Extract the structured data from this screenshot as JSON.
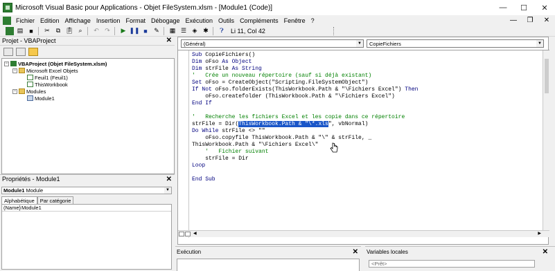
{
  "window": {
    "title": "Microsoft Visual Basic pour Applications - Objet FileSystem.xlsm - [Module1 (Code)]",
    "controls": {
      "minimize": "—",
      "maximize": "☐",
      "close": "✕"
    }
  },
  "menubar": {
    "items": [
      "Fichier",
      "Edition",
      "Affichage",
      "Insertion",
      "Format",
      "Débogage",
      "Exécution",
      "Outils",
      "Compléments",
      "Fenêtre",
      "?"
    ],
    "doc_controls": {
      "minimize": "—",
      "restore": "❐",
      "close": "✕"
    }
  },
  "toolbar": {
    "position": "Li 11, Col 42",
    "icons": [
      "excel-icon",
      "insert-icon",
      "save-icon",
      "cut-icon",
      "copy-icon",
      "paste-icon",
      "find-icon",
      "undo-icon",
      "redo-icon",
      "run-icon",
      "break-icon",
      "reset-icon",
      "design-icon",
      "project-explorer-icon",
      "properties-icon",
      "object-browser-icon",
      "toolbox-icon",
      "help-icon"
    ]
  },
  "project_panel": {
    "title": "Projet - VBAProject",
    "close": "✕",
    "tree": [
      {
        "level": 0,
        "expander": "−",
        "icon": "vba",
        "label": "VBAProject (Objet FileSystem.xlsm)",
        "bold": true
      },
      {
        "level": 1,
        "expander": "−",
        "icon": "folder",
        "label": "Microsoft Excel Objets"
      },
      {
        "level": 2,
        "expander": "",
        "icon": "sheet",
        "label": "Feuil1 (Feuil1)"
      },
      {
        "level": 2,
        "expander": "",
        "icon": "sheet",
        "label": "ThisWorkbook"
      },
      {
        "level": 1,
        "expander": "−",
        "icon": "folder",
        "label": "Modules"
      },
      {
        "level": 2,
        "expander": "",
        "icon": "module",
        "label": "Module1"
      }
    ]
  },
  "properties_panel": {
    "title": "Propriétés - Module1",
    "close": "✕",
    "object_name": "Module1",
    "object_type": "Module",
    "tabs": [
      "Alphabétique",
      "Par catégorie"
    ],
    "rows": [
      {
        "key": "(Name)",
        "value": "Module1"
      }
    ]
  },
  "code_window": {
    "object_combo": "(Général)",
    "procedure_combo": "CopieFichiers",
    "lines": [
      [
        {
          "t": "Sub ",
          "c": "kw"
        },
        {
          "t": "CopieFichiers()",
          "c": ""
        }
      ],
      [
        {
          "t": "Dim ",
          "c": "kw"
        },
        {
          "t": "oFso ",
          "c": ""
        },
        {
          "t": "As Object",
          "c": "kw"
        }
      ],
      [
        {
          "t": "Dim ",
          "c": "kw"
        },
        {
          "t": "strFile ",
          "c": ""
        },
        {
          "t": "As String",
          "c": "kw"
        }
      ],
      [
        {
          "t": "'   Crée un nouveau répertoire (sauf si déjà existant)",
          "c": "cm"
        }
      ],
      [
        {
          "t": "Set ",
          "c": "kw"
        },
        {
          "t": "oFso = CreateObject(\"Scripting.FileSystemObject\")",
          "c": ""
        }
      ],
      [
        {
          "t": "If Not ",
          "c": "kw"
        },
        {
          "t": "oFso.folderExists(ThisWorkbook.Path & \"\\Fichiers Excel\") ",
          "c": ""
        },
        {
          "t": "Then",
          "c": "kw"
        }
      ],
      [
        {
          "t": "    oFso.createfolder (ThisWorkbook.Path & \"\\Fichiers Excel\")",
          "c": ""
        }
      ],
      [
        {
          "t": "End If",
          "c": "kw"
        }
      ],
      [
        {
          "t": "",
          "c": ""
        }
      ],
      [
        {
          "t": "'   Recherche les fichiers Excel et les copie dans ce répertoire",
          "c": "cm"
        }
      ],
      [
        {
          "t": "strFile = Dir(",
          "c": ""
        },
        {
          "t": "ThisWorkbook.Path & \"\\*.xls",
          "c": "sel"
        },
        {
          "t": "\", vbNormal)",
          "c": ""
        }
      ],
      [
        {
          "t": "Do While ",
          "c": "kw"
        },
        {
          "t": "strFile <> \"\"",
          "c": ""
        }
      ],
      [
        {
          "t": "    oFso.copyfile ThisWorkbook.Path & \"\\\" & strFile, _",
          "c": ""
        }
      ],
      [
        {
          "t": "ThisWorkbook.Path & \"\\Fichiers Excel\\\"",
          "c": ""
        }
      ],
      [
        {
          "t": "    '   Fichier suivant",
          "c": "cm"
        }
      ],
      [
        {
          "t": "    strFile = Dir",
          "c": ""
        }
      ],
      [
        {
          "t": "Loop",
          "c": "kw"
        }
      ],
      [
        {
          "t": "",
          "c": ""
        }
      ],
      [
        {
          "t": "End Sub",
          "c": "kw"
        }
      ]
    ]
  },
  "immediate_pane": {
    "title": "Exécution",
    "close": "✕"
  },
  "locals_pane": {
    "title": "Variables locales",
    "close": "✕",
    "status": "<Prêt>"
  }
}
